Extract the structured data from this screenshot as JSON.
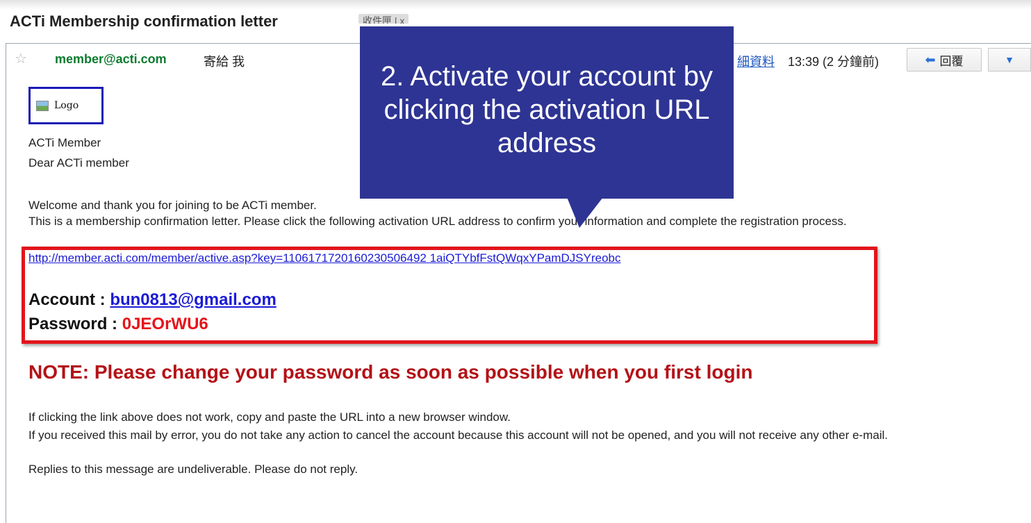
{
  "email": {
    "subject": "ACTi Membership confirmation letter",
    "label_chip": "收件匣 | x",
    "sender": "member@acti.com",
    "to_me": "寄給 我",
    "details_link": "細資料",
    "timestamp": "13:39 (2 分鐘前)",
    "reply_label": "回覆",
    "logo_alt": "Logo",
    "org_line": "ACTi Member",
    "greeting": "Dear ACTi member",
    "welcome_line": "Welcome and thank you for joining to be ACTi member.",
    "confirm_line": "This is a membership confirmation letter. Please click the following activation URL address to confirm your information and complete the registration process.",
    "activation_url": "http://member.acti.com/member/active.asp?key=1106171720160230506492 1aiQTYbfFstQWqxYPamDJSYreobc",
    "account_label": "Account : ",
    "account_value": "bun0813@gmail.com",
    "password_label": "Password : ",
    "password_value": "0JEOrWU6",
    "note": "NOTE: Please change your password as soon as possible when you first login",
    "footer_1": "If clicking the link above does not work, copy and paste the URL into a new browser window.",
    "footer_2": "If you received this mail by error, you do not take any action to cancel the account because this account will not be opened, and you will not receive any other e-mail.",
    "footer_3": "Replies to this message are undeliverable. Please do not reply."
  },
  "callout": {
    "text": "2. Activate your account by clicking the activation URL address"
  },
  "colors": {
    "callout_bg": "#2e3493",
    "highlight_border": "#e2141c",
    "note_red": "#b31217",
    "sender_green": "#0c7b2e",
    "link_blue": "#1b1bd6"
  }
}
